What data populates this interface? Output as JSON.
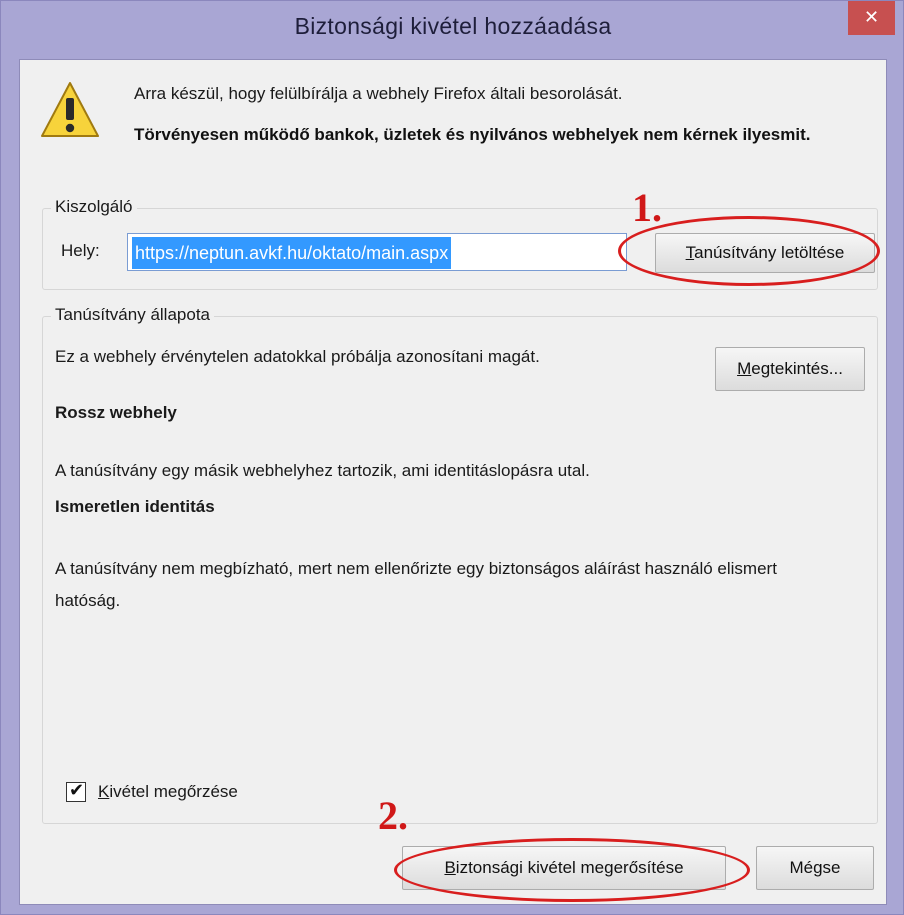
{
  "window": {
    "title": "Biztonsági kivétel hozzáadása",
    "close_icon": "close-icon"
  },
  "warning": {
    "icon": "warning-icon",
    "message": "Arra készül, hogy felülbírálja a webhely Firefox általi besorolását.",
    "bold_message": "Törvényesen működő bankok, üzletek és nyilvános webhelyek nem kérnek ilyesmit."
  },
  "server": {
    "legend": "Kiszolgáló",
    "location_label": "Hely:",
    "url_value": "https://neptun.avkf.hu/oktato/main.aspx",
    "download_button_underline": "T",
    "download_button_rest": "anúsítvány letöltése"
  },
  "certificate": {
    "legend": "Tanúsítvány állapota",
    "status_text": "Ez a webhely érvénytelen adatokkal próbálja azonosítani magát.",
    "view_button_underline": "M",
    "view_button_rest": "egtekintés...",
    "issue1_title": "Rossz webhely",
    "issue1_text": "A tanúsítvány egy másik webhelyhez tartozik, ami identitáslopásra utal.",
    "issue2_title": "Ismeretlen identitás",
    "issue2_text": "A tanúsítvány nem megbízható, mert nem ellenőrizte egy biztonságos aláírást használó elismert hatóság."
  },
  "options": {
    "keep_exception_underline": "K",
    "keep_exception_rest": "ivétel megőrzése",
    "keep_exception_checked": true,
    "check_mark": "✔"
  },
  "footer": {
    "confirm_underline": "B",
    "confirm_rest": "iztonsági kivétel megerősítése",
    "cancel_label": "Mégse"
  },
  "annotations": {
    "step1": "1.",
    "step2": "2.",
    "color": "#d01818"
  }
}
